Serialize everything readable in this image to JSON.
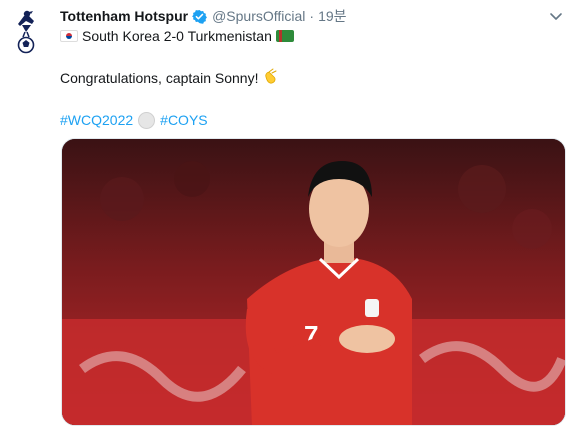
{
  "tweet": {
    "display_name": "Tottenham Hotspur",
    "handle": "@SpursOfficial",
    "separator": "·",
    "time": "19분",
    "line1": "South Korea 2-0 Turkmenistan",
    "line2": "Congratulations, captain Sonny!",
    "hashtag1": "#WCQ2022",
    "hashtag2": "#COYS"
  },
  "icons": {
    "avatar": "tottenham-crest-icon",
    "verified": "verified-badge-icon",
    "menu": "chevron-down-icon",
    "flag_left": "south-korea-flag-icon",
    "flag_right": "turkmenistan-flag-icon",
    "emoji": "clapping-hands-icon",
    "ball": "football-emoji-icon"
  },
  "colors": {
    "link": "#1da1f2",
    "verified": "#1da1f2",
    "jersey": "#d8322a"
  }
}
